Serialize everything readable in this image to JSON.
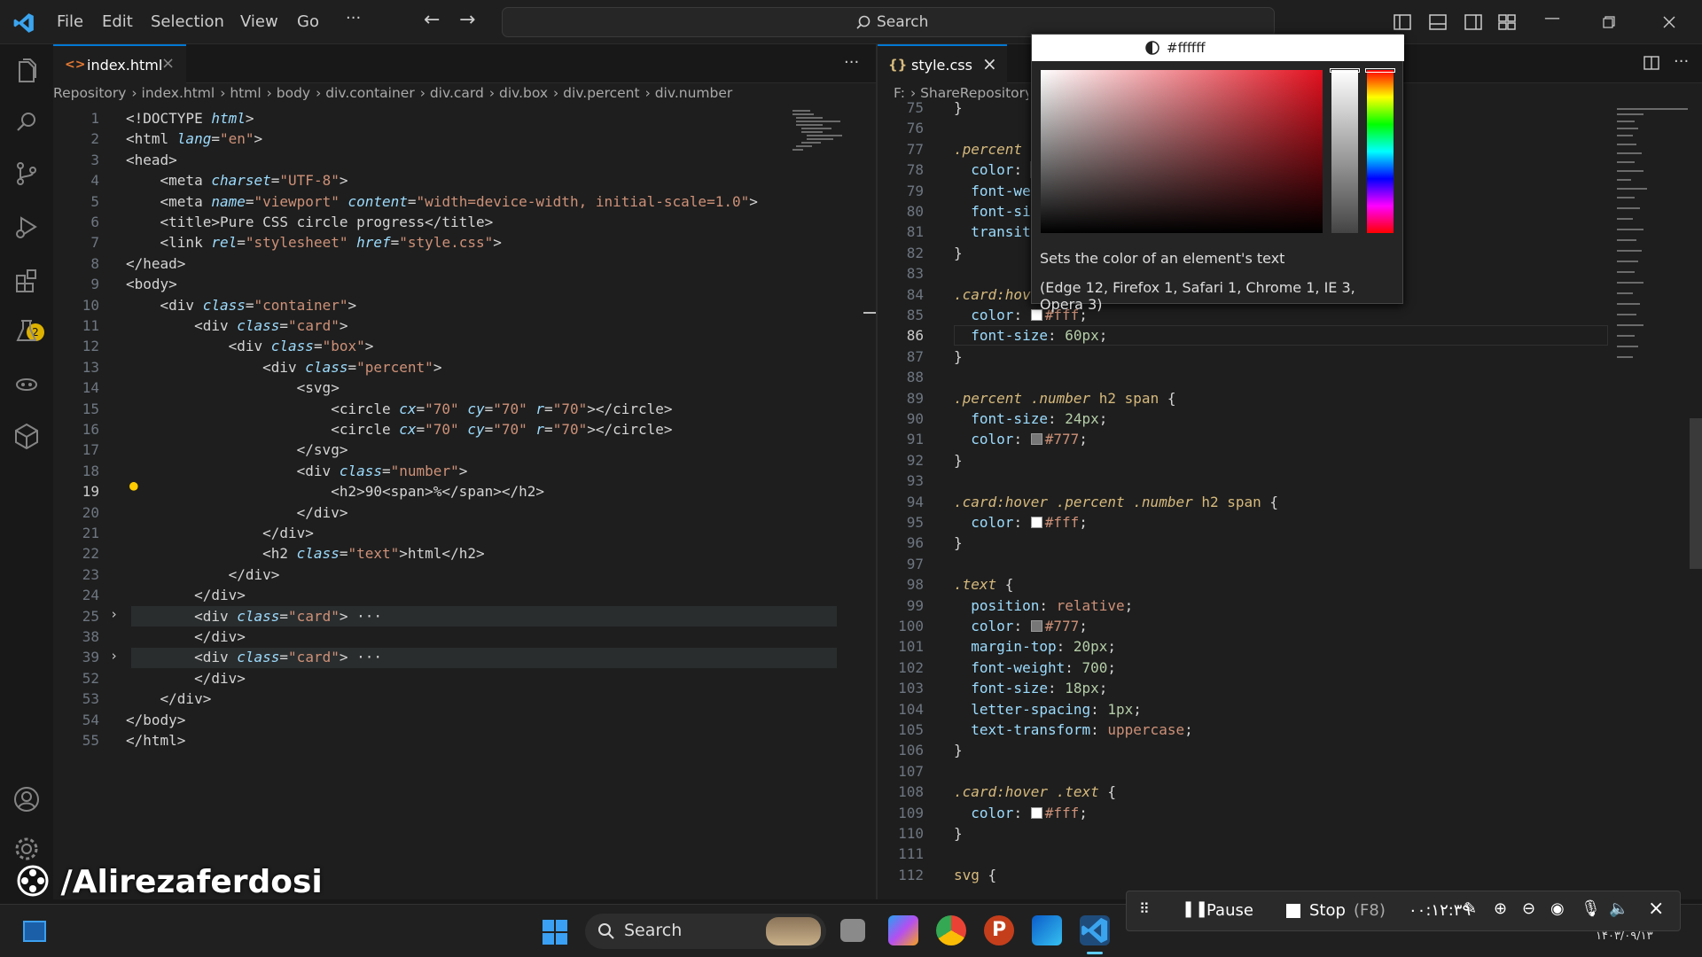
{
  "titlebar": {
    "menus": [
      "File",
      "Edit",
      "Selection",
      "View",
      "Go"
    ],
    "more": "···",
    "search_label": "Search"
  },
  "activity": {
    "extensions_badge": "2"
  },
  "left_editor": {
    "tab_label": "index.html",
    "breadcrumbs": [
      "Repository",
      "index.html",
      "html",
      "body",
      "div.container",
      "div.card",
      "div.box",
      "div.percent",
      "div.number"
    ],
    "lines": [
      {
        "n": "1",
        "s": [
          [
            "t-txt",
            "<!DOCTYPE "
          ],
          [
            "t-attr",
            "html"
          ],
          [
            "t-txt",
            ">"
          ]
        ]
      },
      {
        "n": "2",
        "s": [
          [
            "t-txt",
            "<html "
          ],
          [
            "t-attr",
            "lang"
          ],
          [
            "t-txt",
            "="
          ],
          [
            "t-str",
            "\"en\""
          ],
          [
            "t-txt",
            ">"
          ]
        ]
      },
      {
        "n": "3",
        "s": [
          [
            "t-txt",
            "<head>"
          ]
        ]
      },
      {
        "n": "4",
        "s": [
          [
            "t-txt",
            "    <meta "
          ],
          [
            "t-attr",
            "charset"
          ],
          [
            "t-txt",
            "="
          ],
          [
            "t-str",
            "\"UTF-8\""
          ],
          [
            "t-txt",
            ">"
          ]
        ]
      },
      {
        "n": "5",
        "s": [
          [
            "t-txt",
            "    <meta "
          ],
          [
            "t-attr",
            "name"
          ],
          [
            "t-txt",
            "="
          ],
          [
            "t-str",
            "\"viewport\" "
          ],
          [
            "t-attr",
            "content"
          ],
          [
            "t-txt",
            "="
          ],
          [
            "t-str",
            "\"width=device-width, initial-scale=1.0\""
          ],
          [
            "t-txt",
            ">"
          ]
        ]
      },
      {
        "n": "6",
        "s": [
          [
            "t-txt",
            "    <title>Pure CSS circle progress</title>"
          ]
        ]
      },
      {
        "n": "7",
        "s": [
          [
            "t-txt",
            "    <link "
          ],
          [
            "t-attr",
            "rel"
          ],
          [
            "t-txt",
            "="
          ],
          [
            "t-str",
            "\"stylesheet\" "
          ],
          [
            "t-attr",
            "href"
          ],
          [
            "t-txt",
            "="
          ],
          [
            "t-str",
            "\"style.css\""
          ],
          [
            "t-txt",
            ">"
          ]
        ]
      },
      {
        "n": "8",
        "s": [
          [
            "t-txt",
            "</head>"
          ]
        ]
      },
      {
        "n": "9",
        "s": [
          [
            "t-txt",
            "<body>"
          ]
        ]
      },
      {
        "n": "10",
        "s": [
          [
            "t-txt",
            "    <div "
          ],
          [
            "t-attr",
            "class"
          ],
          [
            "t-txt",
            "="
          ],
          [
            "t-str",
            "\"container\""
          ],
          [
            "t-txt",
            ">"
          ]
        ]
      },
      {
        "n": "11",
        "s": [
          [
            "t-txt",
            "        <div "
          ],
          [
            "t-attr",
            "class"
          ],
          [
            "t-txt",
            "="
          ],
          [
            "t-str",
            "\"card\""
          ],
          [
            "t-txt",
            ">"
          ]
        ]
      },
      {
        "n": "12",
        "s": [
          [
            "t-txt",
            "            <div "
          ],
          [
            "t-attr",
            "class"
          ],
          [
            "t-txt",
            "="
          ],
          [
            "t-str",
            "\"box\""
          ],
          [
            "t-txt",
            ">"
          ]
        ]
      },
      {
        "n": "13",
        "s": [
          [
            "t-txt",
            "                <div "
          ],
          [
            "t-attr",
            "class"
          ],
          [
            "t-txt",
            "="
          ],
          [
            "t-str",
            "\"percent\""
          ],
          [
            "t-txt",
            ">"
          ]
        ]
      },
      {
        "n": "14",
        "s": [
          [
            "t-txt",
            "                    <svg>"
          ]
        ]
      },
      {
        "n": "15",
        "s": [
          [
            "t-txt",
            "                        <circle "
          ],
          [
            "t-attr",
            "cx"
          ],
          [
            "t-txt",
            "="
          ],
          [
            "t-str",
            "\"70\" "
          ],
          [
            "t-attr",
            "cy"
          ],
          [
            "t-txt",
            "="
          ],
          [
            "t-str",
            "\"70\" "
          ],
          [
            "t-attr",
            "r"
          ],
          [
            "t-txt",
            "="
          ],
          [
            "t-str",
            "\"70\""
          ],
          [
            "t-txt",
            "></circle>"
          ]
        ]
      },
      {
        "n": "16",
        "s": [
          [
            "t-txt",
            "                        <circle "
          ],
          [
            "t-attr",
            "cx"
          ],
          [
            "t-txt",
            "="
          ],
          [
            "t-str",
            "\"70\" "
          ],
          [
            "t-attr",
            "cy"
          ],
          [
            "t-txt",
            "="
          ],
          [
            "t-str",
            "\"70\" "
          ],
          [
            "t-attr",
            "r"
          ],
          [
            "t-txt",
            "="
          ],
          [
            "t-str",
            "\"70\""
          ],
          [
            "t-txt",
            "></circle>"
          ]
        ]
      },
      {
        "n": "17",
        "s": [
          [
            "t-txt",
            "                    </svg>"
          ]
        ]
      },
      {
        "n": "18",
        "s": [
          [
            "t-txt",
            "                    <div "
          ],
          [
            "t-attr",
            "class"
          ],
          [
            "t-txt",
            "="
          ],
          [
            "t-str",
            "\"number\""
          ],
          [
            "t-txt",
            ">"
          ]
        ]
      },
      {
        "n": "19",
        "s": [
          [
            "t-txt",
            "                        <h2>90<span>%</span></h2>"
          ]
        ]
      },
      {
        "n": "20",
        "s": [
          [
            "t-txt",
            "                    </div>"
          ]
        ]
      },
      {
        "n": "21",
        "s": [
          [
            "t-txt",
            "                </div>"
          ]
        ]
      },
      {
        "n": "22",
        "s": [
          [
            "t-txt",
            "                <h2 "
          ],
          [
            "t-attr",
            "class"
          ],
          [
            "t-txt",
            "="
          ],
          [
            "t-str",
            "\"text\""
          ],
          [
            "t-txt",
            ">html</h2>"
          ]
        ]
      },
      {
        "n": "23",
        "s": [
          [
            "t-txt",
            "            </div>"
          ]
        ]
      },
      {
        "n": "24",
        "s": [
          [
            "t-txt",
            "        </div>"
          ]
        ]
      },
      {
        "n": "25",
        "s": [
          [
            "t-txt",
            "        <div "
          ],
          [
            "t-attr",
            "class"
          ],
          [
            "t-txt",
            "="
          ],
          [
            "t-str",
            "\"card\""
          ],
          [
            "t-txt",
            ">"
          ],
          [
            "t-txt",
            " ···"
          ]
        ]
      },
      {
        "n": "38",
        "s": [
          [
            "t-txt",
            "        </div>"
          ]
        ]
      },
      {
        "n": "39",
        "s": [
          [
            "t-txt",
            "        <div "
          ],
          [
            "t-attr",
            "class"
          ],
          [
            "t-txt",
            "="
          ],
          [
            "t-str",
            "\"card\""
          ],
          [
            "t-txt",
            ">"
          ],
          [
            "t-txt",
            " ···"
          ]
        ]
      },
      {
        "n": "52",
        "s": [
          [
            "t-txt",
            "        </div>"
          ]
        ]
      },
      {
        "n": "53",
        "s": [
          [
            "t-txt",
            "    </div>"
          ]
        ]
      },
      {
        "n": "54",
        "s": [
          [
            "t-txt",
            "</body>"
          ]
        ]
      },
      {
        "n": "55",
        "s": [
          [
            "t-txt",
            "</html>"
          ]
        ]
      }
    ]
  },
  "right_editor": {
    "tab_label": "style.css",
    "breadcrumbs": [
      "F:",
      "ShareRepository"
    ],
    "lines": [
      {
        "n": "75",
        "s": [
          [
            "c-pun",
            "}"
          ]
        ]
      },
      {
        "n": "76",
        "s": []
      },
      {
        "n": "77",
        "s": [
          [
            "c-sel",
            ".percent ."
          ]
        ]
      },
      {
        "n": "78",
        "s": [
          [
            "c-prop",
            "  color"
          ],
          [
            "c-pun",
            ": ▌"
          ]
        ]
      },
      {
        "n": "79",
        "s": [
          [
            "c-prop",
            "  font-wei"
          ]
        ]
      },
      {
        "n": "80",
        "s": [
          [
            "c-prop",
            "  font-siz"
          ]
        ]
      },
      {
        "n": "81",
        "s": [
          [
            "c-prop",
            "  transiti"
          ]
        ]
      },
      {
        "n": "82",
        "s": [
          [
            "c-pun",
            "}"
          ]
        ]
      },
      {
        "n": "83",
        "s": []
      },
      {
        "n": "84",
        "s": [
          [
            "c-sel",
            ".card:hove"
          ]
        ]
      },
      {
        "n": "85",
        "s": [
          [
            "c-prop",
            "  color"
          ],
          [
            "c-pun",
            ": "
          ],
          [
            "sw",
            "#ffffff"
          ],
          [
            "c-val",
            "#fff"
          ],
          [
            "c-pun",
            ";"
          ]
        ]
      },
      {
        "n": "86",
        "s": [
          [
            "c-prop",
            "  font-size"
          ],
          [
            "c-pun",
            ": "
          ],
          [
            "c-num",
            "60px"
          ],
          [
            "c-pun",
            ";"
          ]
        ]
      },
      {
        "n": "87",
        "s": [
          [
            "c-pun",
            "}"
          ]
        ]
      },
      {
        "n": "88",
        "s": []
      },
      {
        "n": "89",
        "s": [
          [
            "c-sel",
            ".percent .number "
          ],
          [
            "c-tag",
            "h2 span"
          ],
          [
            "c-pun",
            " {"
          ]
        ]
      },
      {
        "n": "90",
        "s": [
          [
            "c-prop",
            "  font-size"
          ],
          [
            "c-pun",
            ": "
          ],
          [
            "c-num",
            "24px"
          ],
          [
            "c-pun",
            ";"
          ]
        ]
      },
      {
        "n": "91",
        "s": [
          [
            "c-prop",
            "  color"
          ],
          [
            "c-pun",
            ": "
          ],
          [
            "sw",
            "#777777"
          ],
          [
            "c-val",
            "#777"
          ],
          [
            "c-pun",
            ";"
          ]
        ]
      },
      {
        "n": "92",
        "s": [
          [
            "c-pun",
            "}"
          ]
        ]
      },
      {
        "n": "93",
        "s": []
      },
      {
        "n": "94",
        "s": [
          [
            "c-sel",
            ".card:hover .percent .number "
          ],
          [
            "c-tag",
            "h2 span"
          ],
          [
            "c-pun",
            " {"
          ]
        ]
      },
      {
        "n": "95",
        "s": [
          [
            "c-prop",
            "  color"
          ],
          [
            "c-pun",
            ": "
          ],
          [
            "sw",
            "#ffffff"
          ],
          [
            "c-val",
            "#fff"
          ],
          [
            "c-pun",
            ";"
          ]
        ]
      },
      {
        "n": "96",
        "s": [
          [
            "c-pun",
            "}"
          ]
        ]
      },
      {
        "n": "97",
        "s": []
      },
      {
        "n": "98",
        "s": [
          [
            "c-sel",
            ".text"
          ],
          [
            "c-pun",
            " {"
          ]
        ]
      },
      {
        "n": "99",
        "s": [
          [
            "c-prop",
            "  position"
          ],
          [
            "c-pun",
            ": "
          ],
          [
            "c-val",
            "relative"
          ],
          [
            "c-pun",
            ";"
          ]
        ]
      },
      {
        "n": "100",
        "s": [
          [
            "c-prop",
            "  color"
          ],
          [
            "c-pun",
            ": "
          ],
          [
            "sw",
            "#777777"
          ],
          [
            "c-val",
            "#777"
          ],
          [
            "c-pun",
            ";"
          ]
        ]
      },
      {
        "n": "101",
        "s": [
          [
            "c-prop",
            "  margin-top"
          ],
          [
            "c-pun",
            ": "
          ],
          [
            "c-num",
            "20px"
          ],
          [
            "c-pun",
            ";"
          ]
        ]
      },
      {
        "n": "102",
        "s": [
          [
            "c-prop",
            "  font-weight"
          ],
          [
            "c-pun",
            ": "
          ],
          [
            "c-num",
            "700"
          ],
          [
            "c-pun",
            ";"
          ]
        ]
      },
      {
        "n": "103",
        "s": [
          [
            "c-prop",
            "  font-size"
          ],
          [
            "c-pun",
            ": "
          ],
          [
            "c-num",
            "18px"
          ],
          [
            "c-pun",
            ";"
          ]
        ]
      },
      {
        "n": "104",
        "s": [
          [
            "c-prop",
            "  letter-spacing"
          ],
          [
            "c-pun",
            ": "
          ],
          [
            "c-num",
            "1px"
          ],
          [
            "c-pun",
            ";"
          ]
        ]
      },
      {
        "n": "105",
        "s": [
          [
            "c-prop",
            "  text-transform"
          ],
          [
            "c-pun",
            ": "
          ],
          [
            "c-val",
            "uppercase"
          ],
          [
            "c-pun",
            ";"
          ]
        ]
      },
      {
        "n": "106",
        "s": [
          [
            "c-pun",
            "}"
          ]
        ]
      },
      {
        "n": "107",
        "s": []
      },
      {
        "n": "108",
        "s": [
          [
            "c-sel",
            ".card:hover .text"
          ],
          [
            "c-pun",
            " {"
          ]
        ]
      },
      {
        "n": "109",
        "s": [
          [
            "c-prop",
            "  color"
          ],
          [
            "c-pun",
            ": "
          ],
          [
            "sw",
            "#ffffff"
          ],
          [
            "c-val",
            "#fff"
          ],
          [
            "c-pun",
            ";"
          ]
        ]
      },
      {
        "n": "110",
        "s": [
          [
            "c-pun",
            "}"
          ]
        ]
      },
      {
        "n": "111",
        "s": []
      },
      {
        "n": "112",
        "s": [
          [
            "c-tag",
            "svg"
          ],
          [
            "c-pun",
            " {"
          ]
        ]
      }
    ]
  },
  "color_picker": {
    "value": "#ffffff",
    "description": "Sets the color of an element's text",
    "compat": "(Edge 12, Firefox 1, Safari 1, Chrome 1, IE 3, Opera 3)"
  },
  "watermark": "/Alirezaferdosi",
  "recorder": {
    "pause": "Pause",
    "stop": "Stop",
    "stop_key": "(F8)",
    "timer": "۰۰:۱۲:۳۹"
  },
  "taskbar": {
    "search_label": "Search",
    "date": "۱۴۰۳/۰۹/۱۳"
  },
  "colors": {
    "accent": "#0078d4"
  }
}
